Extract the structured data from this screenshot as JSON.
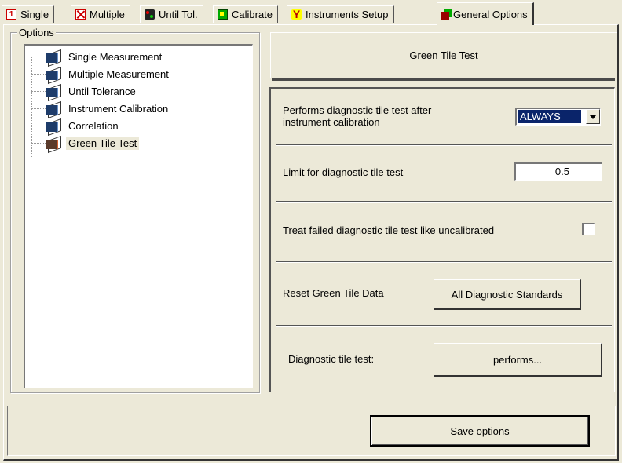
{
  "tabs": [
    {
      "label": "Single",
      "icon": "single-measure-icon"
    },
    {
      "label": "Multiple",
      "icon": "multiple-measure-icon"
    },
    {
      "label": "Until Tol.",
      "icon": "until-tolerance-icon"
    },
    {
      "label": "Calibrate",
      "icon": "calibrate-icon"
    },
    {
      "label": "Instruments Setup",
      "icon": "instruments-setup-icon"
    },
    {
      "label": "General Options",
      "icon": "general-options-icon"
    }
  ],
  "active_tab": "General Options",
  "options_group": {
    "title": "Options",
    "tree": [
      {
        "label": "Single Measurement",
        "icon": "book-icon"
      },
      {
        "label": "Multiple Measurement",
        "icon": "book-icon"
      },
      {
        "label": "Until Tolerance",
        "icon": "book-icon"
      },
      {
        "label": "Instrument Calibration",
        "icon": "book-icon"
      },
      {
        "label": "Correlation",
        "icon": "book-icon"
      },
      {
        "label": "Green Tile Test",
        "icon": "book-open-icon"
      }
    ],
    "selected": "Green Tile Test"
  },
  "panel": {
    "title": "Green Tile Test",
    "rows": {
      "performs_label": "Performs diagnostic tile test after instrument calibration",
      "performs_value": "ALWAYS",
      "limit_label": "Limit for diagnostic tile test",
      "limit_value": "0.5",
      "treat_label": "Treat failed diagnostic tile test like uncalibrated",
      "treat_checked": false,
      "reset_label": "Reset Green Tile Data",
      "reset_button": "All Diagnostic Standards",
      "diag_label": "Diagnostic tile test:",
      "diag_button": "performs..."
    }
  },
  "footer": {
    "save_button": "Save options"
  }
}
